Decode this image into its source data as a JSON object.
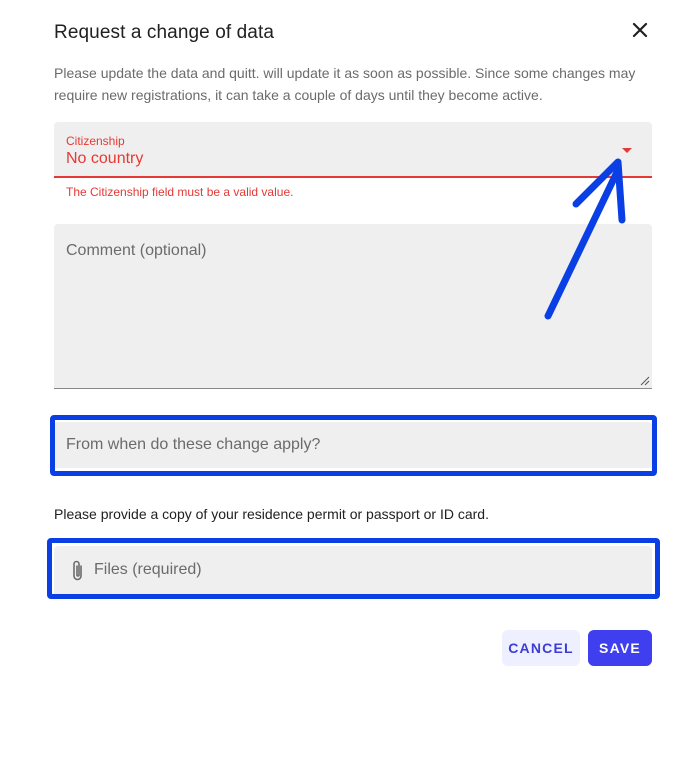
{
  "dialog": {
    "title": "Request a change of data",
    "description": "Please update the data and quitt. will update it as soon as possible. Since some changes may require new registrations, it can take a couple of days until they become active."
  },
  "citizenship": {
    "label": "Citizenship",
    "value": "No country",
    "error": "The Citizenship field must be a valid value."
  },
  "comment": {
    "placeholder": "Comment (optional)"
  },
  "date_field": {
    "placeholder": "From when do these change apply?"
  },
  "hint": "Please provide a copy of your residence permit or passport or ID card.",
  "files": {
    "placeholder": "Files (required)",
    "icon": "paperclip-icon"
  },
  "actions": {
    "cancel_label": "CANCEL",
    "save_label": "SAVE"
  },
  "colors": {
    "error": "#e53935",
    "primary": "#3f3ff0",
    "annotation": "#0a3fe6",
    "field_bg": "#efefef"
  }
}
